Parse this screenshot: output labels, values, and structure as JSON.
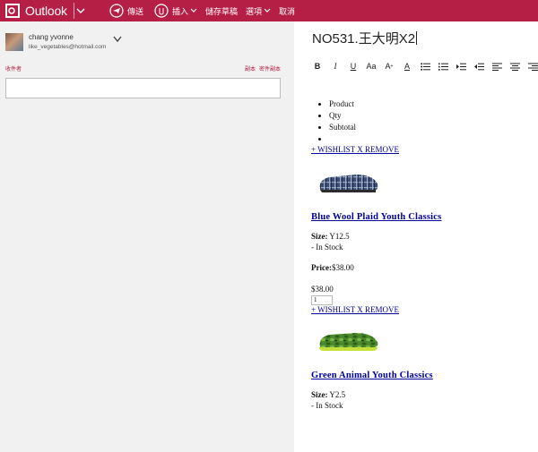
{
  "app": {
    "brand": "Outlook"
  },
  "toolbar": {
    "send_label": "傳送",
    "insert_label": "插入",
    "save_draft_label": "儲存草稿",
    "options_label": "選項",
    "cancel_label": "取消"
  },
  "account": {
    "name": "chang yvonne",
    "email": "like_vegetables@hotmail.com"
  },
  "compose": {
    "recipient_label": "收件者",
    "cc_label": "副本",
    "bcc_label": "密件副本",
    "to_value": "",
    "subject": "NO531.王大明X2"
  },
  "format_toolbar": [
    "B",
    "I",
    "U",
    "Aa",
    "A",
    "A",
    "list",
    "list",
    "indent",
    "outdent",
    "align",
    "align",
    "align",
    "link"
  ],
  "body": {
    "list_items": [
      "Product",
      "Qty",
      "Subtotal",
      ""
    ],
    "products": [
      {
        "actions": "+ WISHLIST X REMOVE",
        "image_icon": "blue-plaid-shoe-image",
        "title": "Blue Wool Plaid Youth Classics",
        "size_label": "Size:",
        "size_value": "Y12.5",
        "stock": "- In Stock",
        "price_label": "Price:",
        "price_value": "$38.00",
        "subtotal": "$38.00",
        "qty": "1"
      },
      {
        "actions": "+ WISHLIST X REMOVE",
        "image_icon": "green-camo-shoe-image",
        "title": "Green Animal Youth Classics",
        "size_label": "Size:",
        "size_value": "Y2.5",
        "stock": "- In Stock"
      }
    ]
  },
  "colors": {
    "accent": "#b51f45",
    "link": "#00009c",
    "left_pane_bg": "#f1f1f1"
  }
}
